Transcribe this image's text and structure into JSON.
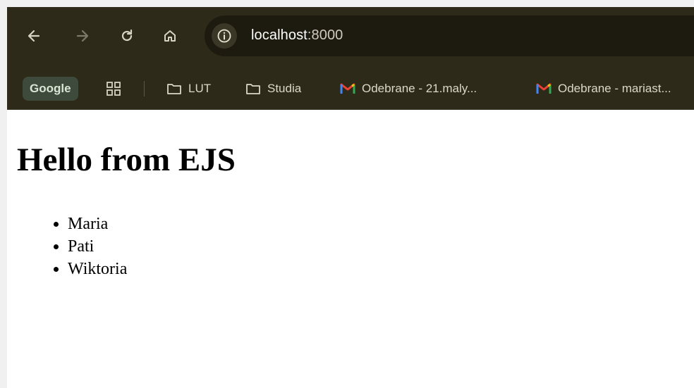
{
  "browser": {
    "address": {
      "host": "localhost",
      "port": ":8000"
    },
    "icons": {
      "back": "arrow-left-icon",
      "forward": "arrow-right-icon",
      "reload": "reload-icon",
      "home": "home-icon",
      "info": "info-icon",
      "apps": "apps-grid-icon",
      "folder": "folder-icon",
      "gmail": "gmail-icon"
    },
    "bookmarks": [
      {
        "label": "Google"
      },
      {
        "label": "LUT"
      },
      {
        "label": "Studia"
      },
      {
        "label": "Odebrane - 21.maly..."
      },
      {
        "label": "Odebrane - mariast..."
      }
    ],
    "colors": {
      "toolbar": "#2d2a1a",
      "omnibox": "#1d1b0f",
      "gmail_red": "#ea4335"
    }
  },
  "page": {
    "heading": "Hello from EJS",
    "items": [
      "Maria",
      "Pati",
      "Wiktoria"
    ]
  }
}
